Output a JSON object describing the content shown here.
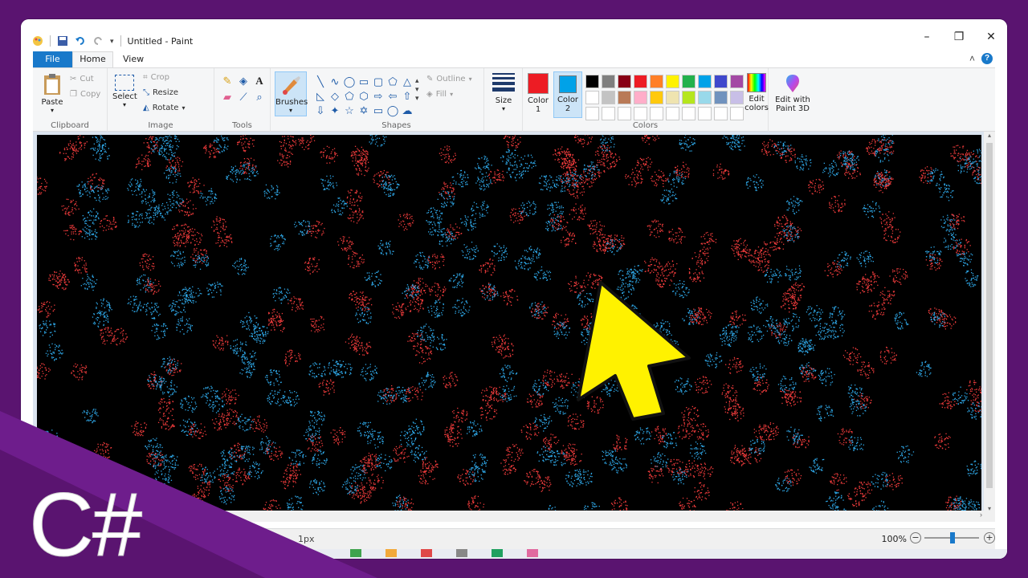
{
  "window": {
    "title": "Untitled - Paint",
    "controls": {
      "minimize": "–",
      "restore": "❐",
      "close": "✕"
    }
  },
  "tabs": [
    {
      "label": "File"
    },
    {
      "label": "Home"
    },
    {
      "label": "View"
    }
  ],
  "ribbon": {
    "clipboard": {
      "paste": "Paste",
      "cut": "Cut",
      "copy": "Copy",
      "label": "Clipboard"
    },
    "image": {
      "select": "Select",
      "crop": "Crop",
      "resize": "Resize",
      "rotate": "Rotate",
      "label": "Image"
    },
    "tools": {
      "label": "Tools"
    },
    "brushes": {
      "label": "Brushes"
    },
    "shapes": {
      "outline": "Outline",
      "fill": "Fill",
      "label": "Shapes"
    },
    "size": {
      "label": "Size"
    },
    "colors": {
      "color1": "Color 1",
      "color2": "Color 2",
      "color1_hex": "#ed1c24",
      "color2_hex": "#00a2e8",
      "edit": "Edit colors",
      "label": "Colors",
      "palette": [
        "#000000",
        "#7f7f7f",
        "#880015",
        "#ed1c24",
        "#ff7f27",
        "#fff200",
        "#22b14c",
        "#00a2e8",
        "#3f48cc",
        "#a349a4",
        "#ffffff",
        "#c3c3c3",
        "#b97a57",
        "#ffaec9",
        "#ffc90e",
        "#efe4b0",
        "#b5e61d",
        "#99d9ea",
        "#7092be",
        "#c8bfe7",
        "#ffffff",
        "#ffffff",
        "#ffffff",
        "#ffffff",
        "#ffffff",
        "#ffffff",
        "#ffffff",
        "#ffffff",
        "#ffffff",
        "#ffffff"
      ]
    },
    "paint3d": {
      "label": "Edit with Paint 3D"
    }
  },
  "canvas": {
    "background": "#000000",
    "spray_colors": [
      "#ed3b3b",
      "#2fa8e8"
    ]
  },
  "statusbar": {
    "size_text": "1px",
    "zoom": "100%",
    "zoom_minus": "−",
    "zoom_plus": "+"
  },
  "overlay": {
    "logo_text": "C#",
    "arrow_color": "#fff200"
  }
}
